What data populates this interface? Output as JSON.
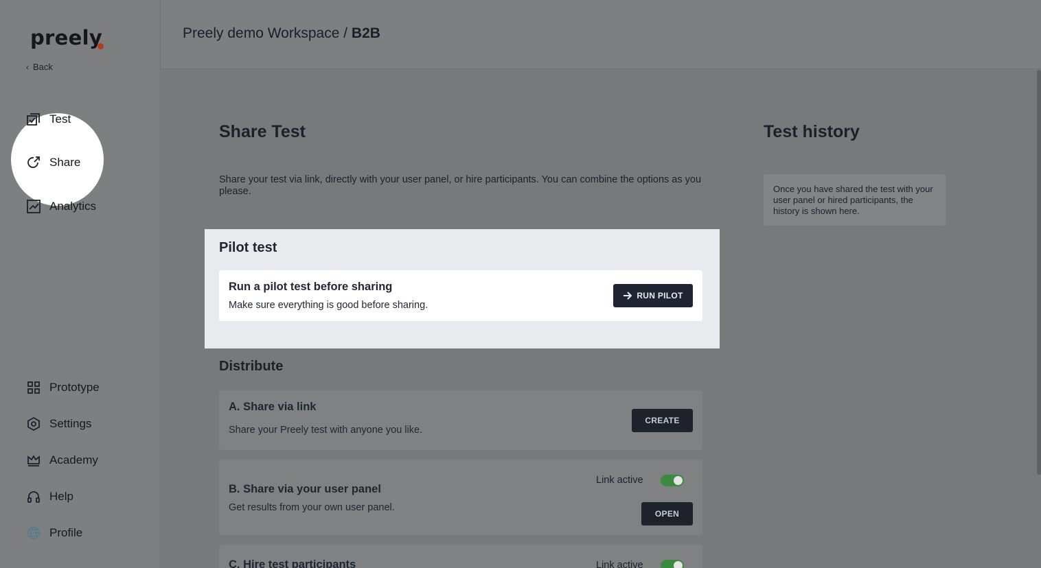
{
  "app": {
    "logo": "preely",
    "back_label": "Back"
  },
  "nav": {
    "top": [
      {
        "label": "Test",
        "icon": "checklist-icon"
      },
      {
        "label": "Share",
        "icon": "share-icon"
      },
      {
        "label": "Analytics",
        "icon": "analytics-icon"
      }
    ],
    "bottom": [
      {
        "label": "Prototype",
        "icon": "grid-icon"
      },
      {
        "label": "Settings",
        "icon": "settings-icon"
      },
      {
        "label": "Academy",
        "icon": "crown-icon"
      },
      {
        "label": "Help",
        "icon": "headset-icon"
      },
      {
        "label": "Profile",
        "icon": "globe-icon"
      }
    ]
  },
  "header": {
    "workspace": "Preely demo Workspace",
    "separator": "/",
    "current": "B2B"
  },
  "share": {
    "title": "Share Test",
    "description": "Share your test via link, directly with your user panel, or hire participants. You can combine the options as you please."
  },
  "history": {
    "title": "Test history",
    "empty_text": "Once you have shared the test with your user panel or hired participants, the history is shown here."
  },
  "pilot": {
    "section_title": "Pilot test",
    "card_title": "Run a pilot test before sharing",
    "card_subtitle": "Make sure everything is good before sharing.",
    "button_label": "RUN PILOT"
  },
  "distribute": {
    "title": "Distribute",
    "link": {
      "title": "A. Share via link",
      "subtitle": "Share your Preely test with anyone you like.",
      "button_label": "CREATE"
    },
    "panel": {
      "title": "B. Share via your user panel",
      "subtitle": "Get results from your own user panel.",
      "status_label": "Link active",
      "active": true,
      "button_label": "OPEN"
    },
    "hire": {
      "title": "C. Hire test participants",
      "status_label": "Link active",
      "active": true
    }
  },
  "colors": {
    "primary_button": "#1f2533",
    "toggle_on": "#3d8a3c",
    "brand_dot": "#b63a1f"
  }
}
